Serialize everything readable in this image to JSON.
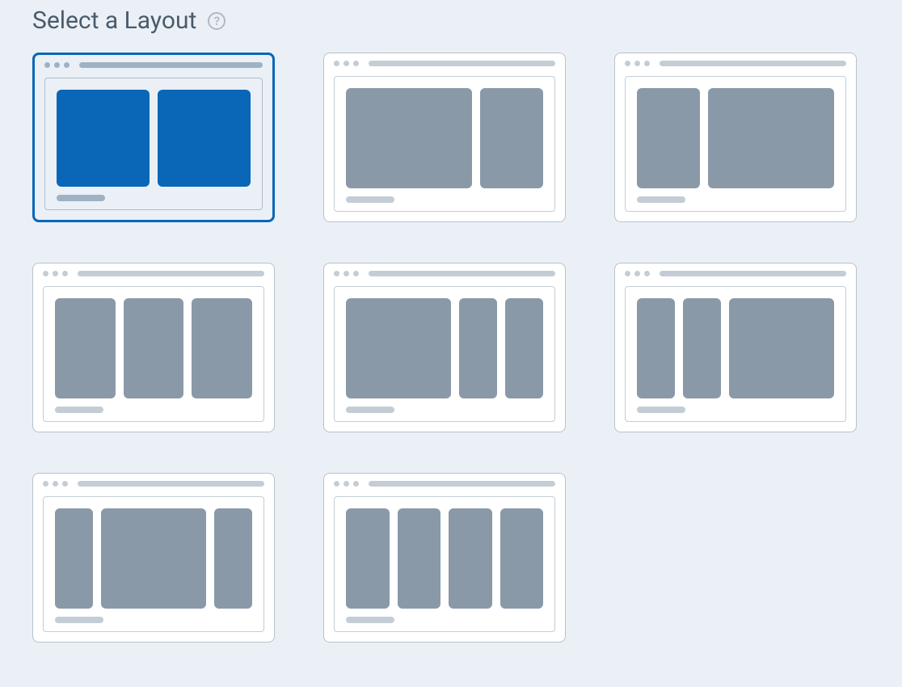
{
  "header": {
    "title": "Select a Layout",
    "help_glyph": "?"
  },
  "layouts": [
    {
      "id": "two-equal",
      "columns": [
        1,
        1
      ],
      "selected": true
    },
    {
      "id": "wide-narrow",
      "columns": [
        2,
        1
      ],
      "selected": false
    },
    {
      "id": "narrow-wide",
      "columns": [
        1,
        2
      ],
      "selected": false
    },
    {
      "id": "three-equal",
      "columns": [
        1,
        1,
        1
      ],
      "selected": false
    },
    {
      "id": "wide-narrow-narrow",
      "columns": [
        2.2,
        0.8,
        0.8
      ],
      "selected": false
    },
    {
      "id": "narrow-narrow-wide",
      "columns": [
        0.8,
        0.8,
        2.2
      ],
      "selected": false
    },
    {
      "id": "narrow-wide-narrow",
      "columns": [
        0.8,
        2.2,
        0.8
      ],
      "selected": false
    },
    {
      "id": "four-equal",
      "columns": [
        1,
        1,
        1,
        1
      ],
      "selected": false
    }
  ]
}
